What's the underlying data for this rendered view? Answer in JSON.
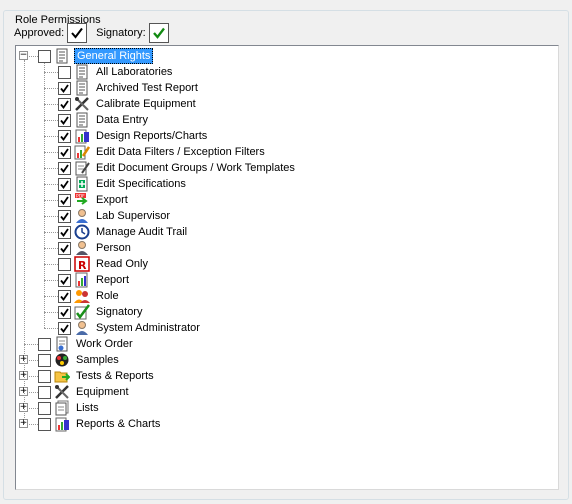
{
  "group_title": "Role Permissions",
  "approved": {
    "label": "Approved:",
    "checked": true
  },
  "signatory": {
    "label": "Signatory:",
    "checked": true
  },
  "tree": {
    "root": {
      "label": "General Rights",
      "checked": false,
      "expanded": true,
      "selected": true,
      "icon": "document-list-icon"
    },
    "children": [
      {
        "label": "All Laboratories",
        "checked": false,
        "icon": "document-list-icon"
      },
      {
        "label": "Archived Test Report",
        "checked": true,
        "icon": "document-list-icon"
      },
      {
        "label": "Calibrate Equipment",
        "checked": true,
        "icon": "tools-icon"
      },
      {
        "label": "Data Entry",
        "checked": true,
        "icon": "document-list-icon"
      },
      {
        "label": "Design Reports/Charts",
        "checked": true,
        "icon": "chart-report-icon"
      },
      {
        "label": "Edit Data Filters / Exception Filters",
        "checked": true,
        "icon": "edit-filter-icon"
      },
      {
        "label": "Edit Document Groups / Work Templates",
        "checked": true,
        "icon": "edit-document-icon"
      },
      {
        "label": "Edit Specifications",
        "checked": true,
        "icon": "specifications-icon"
      },
      {
        "label": "Export",
        "checked": true,
        "icon": "export-icon"
      },
      {
        "label": "Lab Supervisor",
        "checked": true,
        "icon": "supervisor-icon"
      },
      {
        "label": "Manage Audit Trail",
        "checked": true,
        "icon": "audit-trail-icon"
      },
      {
        "label": "Person",
        "checked": true,
        "icon": "person-icon"
      },
      {
        "label": "Read Only",
        "checked": false,
        "icon": "read-only-icon"
      },
      {
        "label": "Report",
        "checked": true,
        "icon": "report-icon"
      },
      {
        "label": "Role",
        "checked": true,
        "icon": "role-icon"
      },
      {
        "label": "Signatory",
        "checked": true,
        "icon": "signatory-icon"
      },
      {
        "label": "System Administrator",
        "checked": true,
        "icon": "administrator-icon"
      }
    ],
    "siblings": [
      {
        "label": "Work Order",
        "checked": false,
        "icon": "work-order-icon",
        "expandable": false
      },
      {
        "label": "Samples",
        "checked": false,
        "icon": "samples-icon",
        "expandable": true
      },
      {
        "label": "Tests & Reports",
        "checked": false,
        "icon": "tests-reports-icon",
        "expandable": true
      },
      {
        "label": "Equipment",
        "checked": false,
        "icon": "equipment-icon",
        "expandable": true
      },
      {
        "label": "Lists",
        "checked": false,
        "icon": "lists-icon",
        "expandable": true
      },
      {
        "label": "Reports & Charts",
        "checked": false,
        "icon": "reports-charts-icon",
        "expandable": true
      }
    ]
  }
}
